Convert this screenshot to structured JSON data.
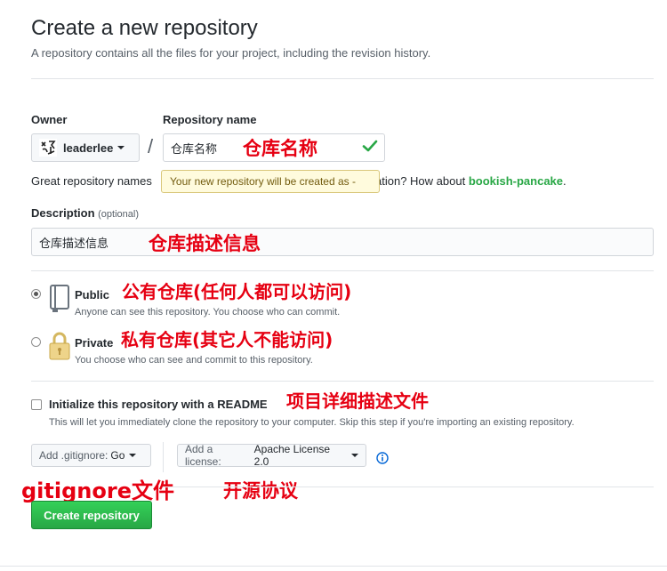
{
  "header": {
    "title": "Create a new repository",
    "subtitle": "A repository contains all the files for your project, including the revision history."
  },
  "owner": {
    "label": "Owner",
    "value": "leaderlee"
  },
  "repo_name": {
    "label": "Repository name",
    "value": "仓库名称",
    "great_text": "Great repository names",
    "great_tail": "ation? How about",
    "suggestion": "bookish-pancake",
    "suggestion_dot": ".",
    "tooltip": "Your new repository will be created as -"
  },
  "description": {
    "label": "Description",
    "optional": "(optional)",
    "value": "仓库描述信息"
  },
  "visibility": {
    "selected": "public",
    "public": {
      "title": "Public",
      "desc": "Anyone can see this repository. You choose who can commit."
    },
    "private": {
      "title": "Private",
      "desc": "You choose who can see and commit to this repository."
    }
  },
  "init": {
    "label": "Initialize this repository with a README",
    "desc": "This will let you immediately clone the repository to your computer. Skip this step if you're importing an existing repository.",
    "checked": false
  },
  "gitignore": {
    "prefix": "Add .gitignore:",
    "value": "Go"
  },
  "license": {
    "prefix": "Add a license:",
    "value": "Apache License 2.0"
  },
  "create_button": "Create repository",
  "annotations": {
    "repo_name": "仓库名称",
    "description": "仓库描述信息",
    "public": "公有仓库(任何人都可以访问)",
    "private": "私有仓库(其它人不能访问)",
    "readme": "项目详细描述文件",
    "gitignore": "gitignore文件",
    "license": "开源协议"
  },
  "colors": {
    "accent_green": "#28a745",
    "annotation_red": "#e60012",
    "tooltip_bg": "#fffbdd"
  }
}
